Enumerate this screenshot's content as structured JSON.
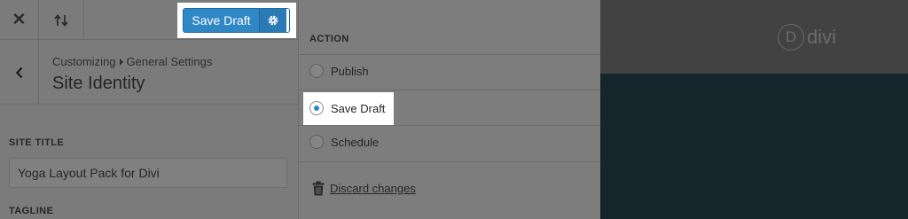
{
  "topbar": {
    "close_icon": "close-icon",
    "sort_icon": "reorder-arrows-icon",
    "save_label": "Save Draft",
    "gear_icon": "gear-icon"
  },
  "crumbs": {
    "back_icon": "chevron-left-icon",
    "parent": "Customizing",
    "child": "General Settings",
    "title": "Site Identity"
  },
  "fields": {
    "site_title_label": "SITE TITLE",
    "site_title_value": "Yoga Layout Pack for Divi",
    "tagline_label": "TAGLINE"
  },
  "action": {
    "heading": "ACTION",
    "options": [
      {
        "label": "Publish",
        "selected": false
      },
      {
        "label": "Save Draft",
        "selected": true
      },
      {
        "label": "Schedule",
        "selected": false
      }
    ],
    "discard_label": "Discard changes",
    "discard_icon": "trash-icon"
  },
  "preview": {
    "logo_letter": "D",
    "logo_word": "divi",
    "header_color": "#424242",
    "body_color": "#14262c"
  },
  "colors": {
    "accent": "#2f87c6",
    "panel": "#7b7b7b"
  }
}
